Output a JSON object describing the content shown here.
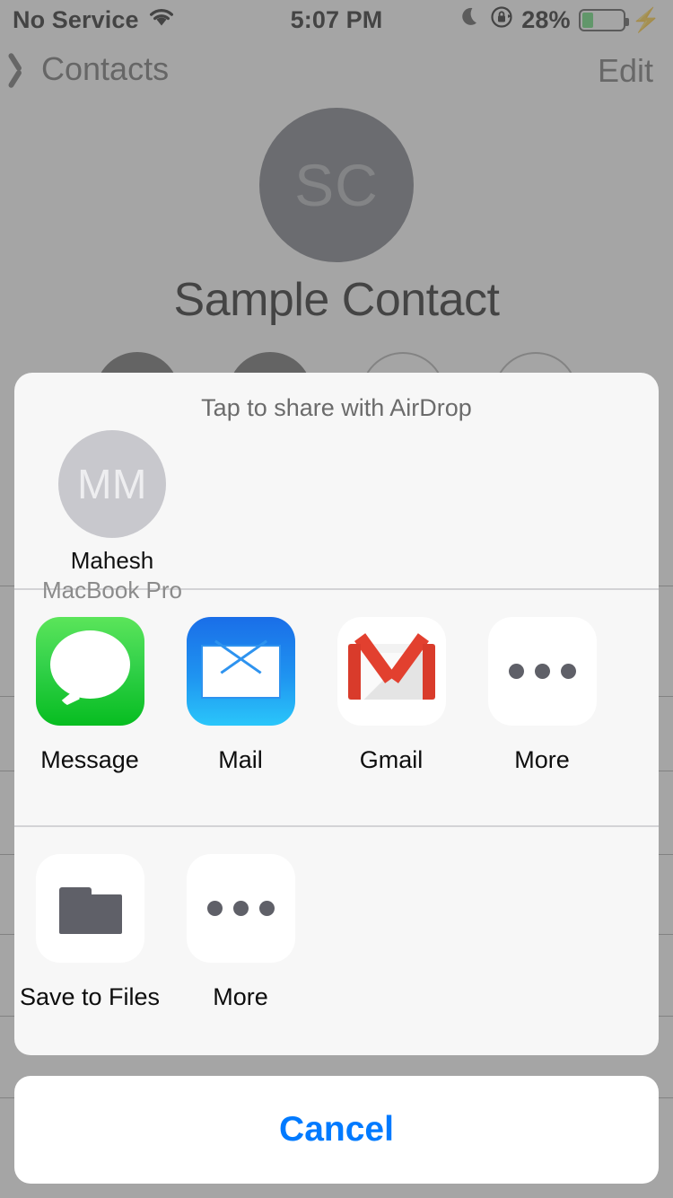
{
  "status_bar": {
    "carrier": "No Service",
    "wifi_icon": "wifi-icon",
    "time": "5:07 PM",
    "dnd_icon": "moon-icon",
    "rotation_lock_icon": "rotation-lock-icon",
    "battery_percent": "28%",
    "battery_level": 28,
    "battery_fill_color": "#4CD964",
    "charging_icon": "lightning-bolt-icon"
  },
  "nav_bar": {
    "back_label": "Contacts",
    "back_icon": "chevron-left-icon",
    "edit_label": "Edit"
  },
  "contact": {
    "initials": "SC",
    "name": "Sample Contact",
    "avatar_color": "#686b74",
    "actions": [
      {
        "name": "message-action",
        "style": "filled"
      },
      {
        "name": "call-action",
        "style": "filled"
      },
      {
        "name": "video-action",
        "style": "outlined"
      },
      {
        "name": "mail-action",
        "style": "outlined"
      }
    ]
  },
  "share_sheet": {
    "title": "Tap to share with AirDrop",
    "airdrop": {
      "initials": "MM",
      "name": "Mahesh",
      "device": "MacBook Pro",
      "circle_color": "#c8c8cd"
    },
    "apps": [
      {
        "label": "Message",
        "icon": "messages-icon"
      },
      {
        "label": "Mail",
        "icon": "mail-icon"
      },
      {
        "label": "Gmail",
        "icon": "gmail-icon"
      },
      {
        "label": "More",
        "icon": "more-dots-icon"
      }
    ],
    "actions": [
      {
        "label": "Save to Files",
        "icon": "folder-icon"
      },
      {
        "label": "More",
        "icon": "more-dots-icon"
      }
    ]
  },
  "cancel": {
    "label": "Cancel",
    "color": "#007AFF"
  }
}
